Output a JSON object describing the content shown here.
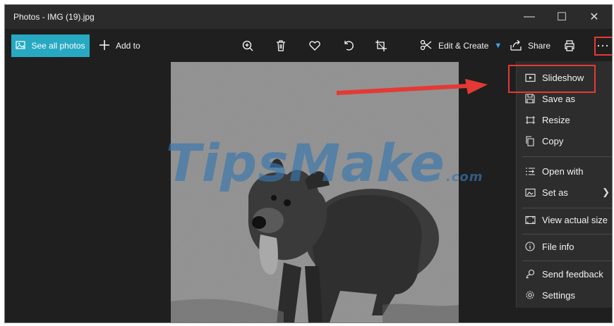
{
  "window": {
    "title": "Photos - IMG (19).jpg"
  },
  "window_controls": {
    "minimize": "—",
    "maximize": "☐",
    "close": "✕"
  },
  "toolbar": {
    "see_all_photos": "See all photos",
    "add_to": "Add to",
    "edit_create": "Edit & Create",
    "share": "Share",
    "more": "···"
  },
  "icons": {
    "toolbar": [
      "zoom-in-icon",
      "delete-icon",
      "favorite-icon",
      "rotate-icon",
      "crop-icon",
      "print-icon"
    ],
    "menu": [
      "slideshow-icon",
      "save-as-icon",
      "resize-icon",
      "copy-icon",
      "open-with-icon",
      "set-as-icon",
      "view-actual-size-icon",
      "file-info-icon",
      "send-feedback-icon",
      "settings-icon"
    ]
  },
  "menu": {
    "slideshow": "Slideshow",
    "save_as": "Save as",
    "resize": "Resize",
    "copy": "Copy",
    "open_with": "Open with",
    "set_as": "Set as",
    "view_actual_size": "View actual size",
    "file_info": "File info",
    "send_feedback": "Send feedback",
    "settings": "Settings"
  },
  "watermark": {
    "main": "TipsMake",
    "suffix": ".com"
  },
  "colors": {
    "accent": "#27a9c2",
    "titlebar": "#2b2b2b",
    "toolbar": "#1f1f1f",
    "menu": "#2d2d2d",
    "highlight": "#e53935"
  }
}
